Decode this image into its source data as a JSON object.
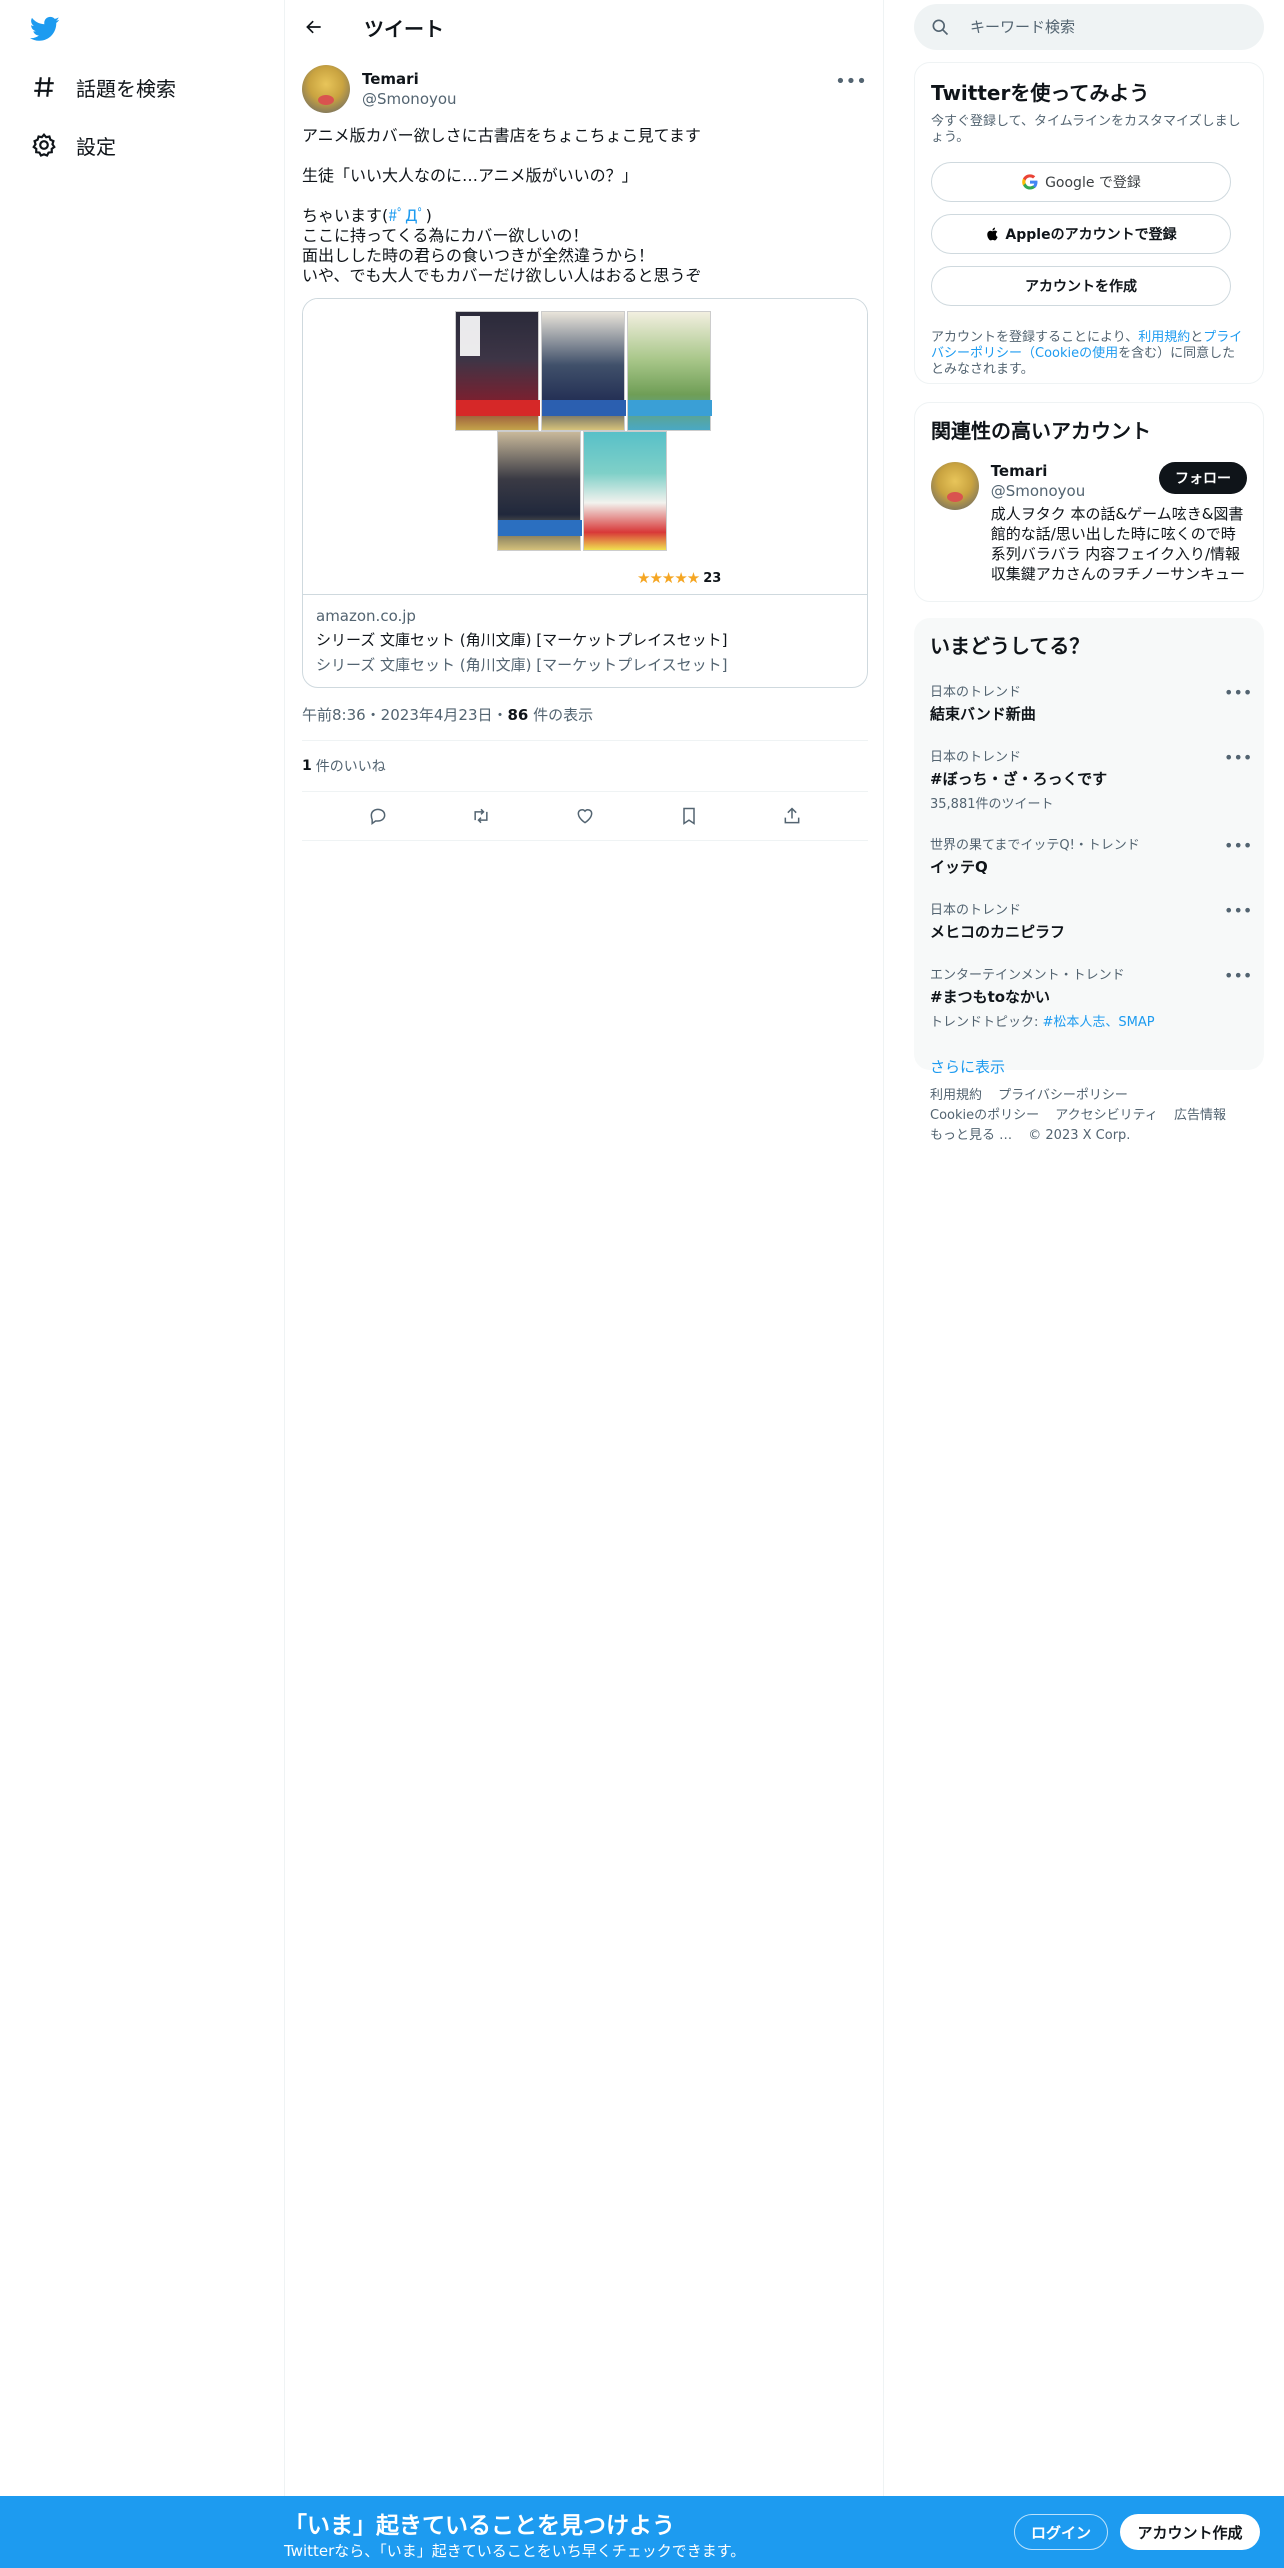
{
  "nav": {
    "items": [
      {
        "label": "話題を検索",
        "icon": "hashtag-icon"
      },
      {
        "label": "設定",
        "icon": "gear-icon"
      }
    ]
  },
  "header": {
    "title": "ツイート"
  },
  "tweet": {
    "author_name": "Temari",
    "author_handle": "@Smonoyou",
    "text_before_hashtag": "アニメ版カバー欲しさに古書店をちょこちょこ見てます\n\n生徒「いい大人なのに…アニメ版がいいの？」\n\nちゃいます(",
    "hashtag": "#ﾟДﾟ",
    "text_after_hashtag": ")\nここに持ってくる為にカバー欲しいの！\n面出しした時の君らの食いつきが全然違うから！\nいや、でも大人でもカバーだけ欲しい人はおると思うぞ",
    "card": {
      "rating_count": "23",
      "domain": "amazon.co.jp",
      "title": "シリーズ 文庫セット (角川文庫) [マーケットプレイスセット]",
      "description": "シリーズ 文庫セット (角川文庫) [マーケットプレイスセット]"
    },
    "time": "午前8:36・2023年4月23日・",
    "views": "86",
    "views_label": " 件の表示",
    "likes": "1",
    "likes_label": "件のいいね"
  },
  "search": {
    "placeholder": "キーワード検索"
  },
  "signup": {
    "title": "Twitterを使ってみよう",
    "subtitle": "今すぐ登録して、タイムラインをカスタマイズしましょう。",
    "google_label": "Google で登録",
    "apple_label": "Appleのアカウントで登録",
    "create_label": "アカウントを作成",
    "terms_prefix": "アカウントを登録することにより、",
    "terms_link": "利用規約",
    "terms_mid": "と",
    "privacy_link": "プライバシーポリシー（Cookieの使用",
    "terms_suffix": "を含む）に同意したとみなされます。"
  },
  "related": {
    "title": "関連性の高いアカウント",
    "name": "Temari",
    "handle": "@Smonoyou",
    "follow_label": "フォロー",
    "bio": "成人ヲタク 本の話&ゲーム呟き&図書館的な話/思い出した時に呟くので時系列バラバラ 内容フェイク入り/情報収集鍵アカさんのヲチノーサンキュー"
  },
  "trends": {
    "title": "いまどうしてる？",
    "items": [
      {
        "meta": "日本のトレンド",
        "name": "結束バンド新曲",
        "extra": ""
      },
      {
        "meta": "日本のトレンド",
        "name": "#ぼっち・ざ・ろっくです",
        "extra": "35,881件のツイート"
      },
      {
        "meta": "世界の果てまでイッテQ!・トレンド",
        "name": "イッテQ",
        "extra": ""
      },
      {
        "meta": "日本のトレンド",
        "name": "メヒコのカニピラフ",
        "extra": ""
      },
      {
        "meta": "エンターテインメント・トレンド",
        "name": "#まつもtoなかい",
        "extra": "トレンドトピック: "
      }
    ],
    "topic_links": "#松本人志、SMAP",
    "show_more": "さらに表示"
  },
  "footer": {
    "links": [
      "利用規約",
      "プライバシーポリシー",
      "Cookieのポリシー",
      "アクセシビリティ",
      "広告情報",
      "もっと見る …",
      "© 2023 X Corp."
    ]
  },
  "bottom_bar": {
    "title": "「いま」起きていることを見つけよう",
    "subtitle": "Twitterなら、「いま」起きていることをいち早くチェックできます。",
    "login_label": "ログイン",
    "signup_label": "アカウント作成"
  },
  "colors": {
    "accent": "#1d9bf0",
    "text": "#0f1419",
    "muted": "#536471"
  }
}
